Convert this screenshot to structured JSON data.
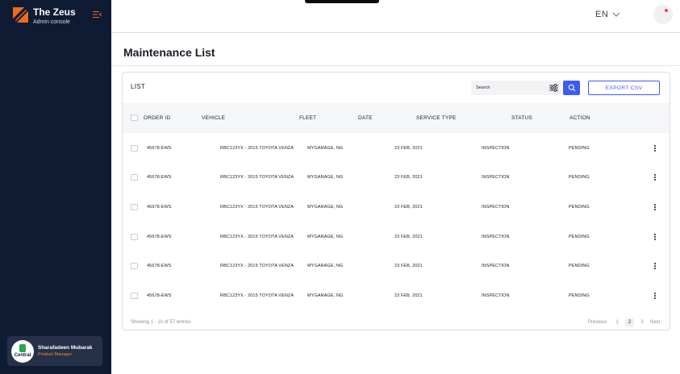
{
  "sidebar": {
    "brand_title": "The Zeus",
    "brand_subtitle": "Admin console",
    "user": {
      "name": "Sharafadeen Mubarak",
      "role": "Product Manager",
      "avatar_label": "Central"
    }
  },
  "topbar": {
    "language": "EN"
  },
  "page": {
    "title": "Maintenance List"
  },
  "list": {
    "title": "LIST",
    "search_placeholder": "Search",
    "export_label": "EXPORT CSV",
    "columns": [
      "ORDER ID",
      "VEHICLE",
      "FLEET",
      "DATE",
      "SERVICE TYPE",
      "STATUS",
      "ACTION"
    ],
    "rows": [
      {
        "order_id": "45678-EWS",
        "vehicle": "RBC123YX - 2015 TOYOTA VENZA",
        "fleet": "MYGARAGE, NG",
        "date": "23 FEB, 2021",
        "service_type": "INSPECTION",
        "status": "PENDING"
      },
      {
        "order_id": "45678-EWS",
        "vehicle": "RBC123YX - 2015 TOYOTA VENZA",
        "fleet": "MYGARAGE, NG",
        "date": "23 FEB, 2021",
        "service_type": "INSPECTION",
        "status": "PENDING"
      },
      {
        "order_id": "45678-EWS",
        "vehicle": "RBC123YX - 2015 TOYOTA VENZA",
        "fleet": "MYGARAGE, NG",
        "date": "23 FEB, 2021",
        "service_type": "INSPECTION",
        "status": "PENDING"
      },
      {
        "order_id": "45678-EWS",
        "vehicle": "RBC123YX - 2015 TOYOTA VENZA",
        "fleet": "MYGARAGE, NG",
        "date": "23 FEB, 2021",
        "service_type": "INSPECTION",
        "status": "PENDING"
      },
      {
        "order_id": "45678-EWS",
        "vehicle": "RBC123YX - 2015 TOYOTA VENZA",
        "fleet": "MYGARAGE, NG",
        "date": "23 FEB, 2021",
        "service_type": "INSPECTION",
        "status": "PENDING"
      },
      {
        "order_id": "45678-EWS",
        "vehicle": "RBC123YX - 2015 TOYOTA VENZA",
        "fleet": "MYGARAGE, NG",
        "date": "23 FEB, 2021",
        "service_type": "INSPECTION",
        "status": "PENDING"
      }
    ],
    "footer": {
      "showing": "Showing 1 - 10 of 57 entries",
      "previous": "Previous",
      "pages": [
        "1",
        "2",
        "3"
      ],
      "active_page": "2",
      "next": "Next"
    }
  },
  "colors": {
    "sidebar_bg": "#0f1a33",
    "accent": "#3d5af1",
    "brand_orange": "#f26b1d",
    "user_role": "#f28c28"
  },
  "icons": {
    "logo": "zeus-logo-icon",
    "collapse": "menu-collapse-icon",
    "chevron": "chevron-down-icon",
    "filter": "filter-sliders-icon",
    "search": "search-icon",
    "row_action": "kebab-menu-icon"
  }
}
